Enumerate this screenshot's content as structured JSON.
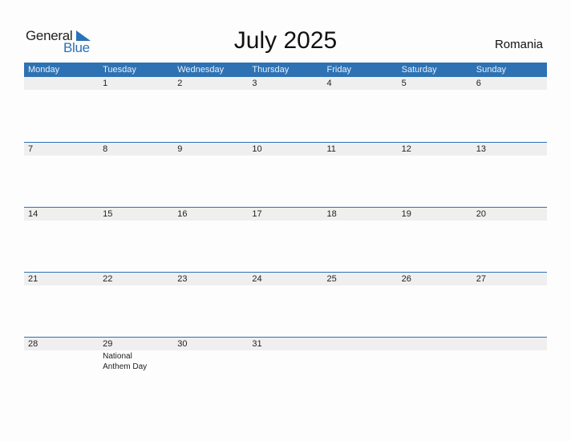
{
  "logo": {
    "line1": "General",
    "line2": "Blue"
  },
  "title": "July 2025",
  "country": "Romania",
  "colors": {
    "accent": "#2e72b4",
    "strip": "#efefef"
  },
  "weekdays": [
    "Monday",
    "Tuesday",
    "Wednesday",
    "Thursday",
    "Friday",
    "Saturday",
    "Sunday"
  ],
  "weeks": [
    {
      "days": [
        "",
        "1",
        "2",
        "3",
        "4",
        "5",
        "6"
      ],
      "events": [
        "",
        "",
        "",
        "",
        "",
        "",
        ""
      ]
    },
    {
      "days": [
        "7",
        "8",
        "9",
        "10",
        "11",
        "12",
        "13"
      ],
      "events": [
        "",
        "",
        "",
        "",
        "",
        "",
        ""
      ]
    },
    {
      "days": [
        "14",
        "15",
        "16",
        "17",
        "18",
        "19",
        "20"
      ],
      "events": [
        "",
        "",
        "",
        "",
        "",
        "",
        ""
      ]
    },
    {
      "days": [
        "21",
        "22",
        "23",
        "24",
        "25",
        "26",
        "27"
      ],
      "events": [
        "",
        "",
        "",
        "",
        "",
        "",
        ""
      ]
    },
    {
      "days": [
        "28",
        "29",
        "30",
        "31",
        "",
        "",
        ""
      ],
      "events": [
        "",
        "National Anthem Day",
        "",
        "",
        "",
        "",
        ""
      ]
    }
  ]
}
